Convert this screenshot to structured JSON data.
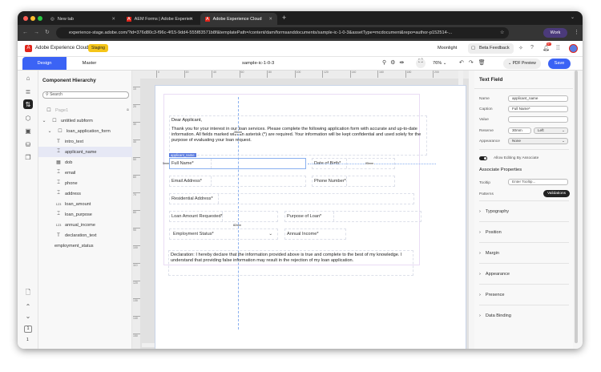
{
  "browser": {
    "tabs": [
      {
        "label": "New tab"
      },
      {
        "label": "AEM Forms | Adobe Experien"
      },
      {
        "label": "Adobe Experience Cloud"
      }
    ],
    "url": "experience-stage.adobe.com/?id=376d80c3-f96c-4f15-9dd4-555f83571b8f&templatePath=/content/dam/formsanddocuments/sample-ic-1-0-3&assetType=mcdocument&repo=author-p152514-...",
    "profile": "Work"
  },
  "app": {
    "name": "Adobe Experience Cloud",
    "env_badge": "Staging",
    "org": "Moonlight",
    "beta_feedback": "Beta Feedback",
    "notif_count": "9+"
  },
  "toolbar": {
    "tab_design": "Design",
    "tab_master": "Master",
    "doc_title": "sample-ic-1-0-3",
    "zoom": "76%",
    "pdf_preview": "PDF Preview",
    "save": "Save"
  },
  "hierarchy": {
    "title": "Component Hierarchy",
    "search_placeholder": "Search",
    "items": [
      {
        "label": "Page1"
      },
      {
        "label": "untitled subform"
      },
      {
        "label": "loan_application_form"
      },
      {
        "label": "intro_text"
      },
      {
        "label": "applicant_name"
      },
      {
        "label": "dob"
      },
      {
        "label": "email"
      },
      {
        "label": "phone"
      },
      {
        "label": "address"
      },
      {
        "label": "loan_amount"
      },
      {
        "label": "loan_purpose"
      },
      {
        "label": "annual_income"
      },
      {
        "label": "declaration_text"
      },
      {
        "label": "employment_status"
      }
    ],
    "page_number": "1",
    "page_count": "1"
  },
  "ruler": {
    "h": [
      "0",
      "20",
      "40",
      "60",
      "80",
      "100",
      "120",
      "140",
      "160",
      "180",
      "200"
    ],
    "v": [
      "10",
      "20",
      "30",
      "40",
      "50",
      "60",
      "70",
      "80",
      "90",
      "100",
      "110",
      "120",
      "130",
      "140",
      "150"
    ]
  },
  "form": {
    "greeting": "Dear Applicant,",
    "intro": "Thank you for your interest in our loan services. Please complete the following application form with accurate and up-to-date information. All fields marked with an asterisk (*) are required. Your information will be kept confidential and used solely for the purpose of evaluating your loan request.",
    "selected_tag": "applicant_name",
    "dim_top": "35mm",
    "dim_left": "5mm",
    "dim_right": "95mm",
    "dim_mid": "82mm",
    "full_name": "Full Name*",
    "dob": "Date of Birth*",
    "email": "Email Address*",
    "phone": "Phone Number*",
    "address": "Residential Address*",
    "loan_amount": "Loan Amount Requested*",
    "loan_purpose": "Purpose of Loan*",
    "employment": "Employment Status*",
    "income": "Annual Income*",
    "declaration": "Declaration: I hereby declare that the information provided above is true and complete to the best of my knowledge. I understand that providing false information may result in the rejection of my loan application."
  },
  "props": {
    "title": "Text Field",
    "name_label": "Name",
    "name": "applicant_name",
    "caption_label": "Caption",
    "caption": "Full Name*",
    "value_label": "Value",
    "value": "",
    "reserve_label": "Reserve",
    "reserve": "30mm",
    "reserve_pos": "Left",
    "appearance_label": "Appearance",
    "appearance": "None",
    "allow_editing": "Allow Editing By Associate",
    "assoc_title": "Associate Properties",
    "tooltip_label": "Tooltip",
    "tooltip_placeholder": "Enter Tooltip...",
    "patterns_label": "Patterns",
    "validations": "Validations",
    "sections": [
      {
        "label": "Typography"
      },
      {
        "label": "Position"
      },
      {
        "label": "Margin"
      },
      {
        "label": "Appearance"
      },
      {
        "label": "Presence"
      },
      {
        "label": "Data Binding"
      }
    ]
  },
  "colors": {
    "accent": "#3b63f5",
    "badge": "#f5c518",
    "adobe_red": "#e1251b"
  }
}
